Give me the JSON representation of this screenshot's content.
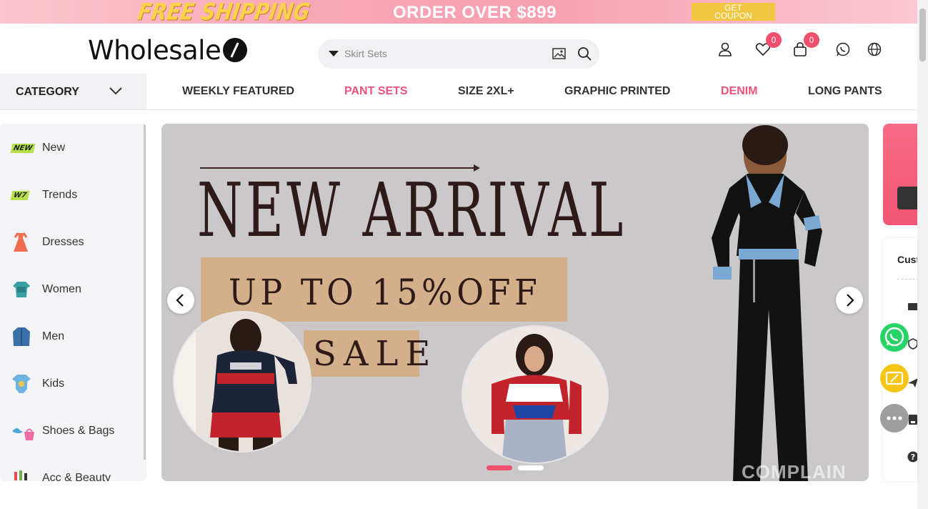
{
  "promo": {
    "free_shipping": "FREE SHIPPING",
    "order_text": "ORDER OVER $899",
    "coupon_line1": "GET",
    "coupon_line2": "COUPON"
  },
  "header": {
    "logo_text": "Wholesale",
    "search_placeholder": "Skirt Sets",
    "wishlist_count": "0",
    "cart_count": "0"
  },
  "nav": {
    "category_label": "CATEGORY",
    "links": [
      {
        "label": "WEEKLY FEATURED"
      },
      {
        "label": "PANT SETS"
      },
      {
        "label": "SIZE 2XL+"
      },
      {
        "label": "GRAPHIC PRINTED"
      },
      {
        "label": "DENIM"
      },
      {
        "label": "LONG PANTS"
      }
    ]
  },
  "sidebar": {
    "items": [
      {
        "label": "New",
        "tag": "NEW"
      },
      {
        "label": "Trends",
        "tag": "W7"
      },
      {
        "label": "Dresses"
      },
      {
        "label": "Women"
      },
      {
        "label": "Men"
      },
      {
        "label": "Kids"
      },
      {
        "label": "Shoes & Bags"
      },
      {
        "label": "Acc & Beauty"
      }
    ]
  },
  "banner": {
    "headline": "NEW ARRIVAL",
    "offer": "UP TO 15%OFF",
    "sale": "SALE",
    "watermark": "COMPLAIN",
    "slide_count": 2,
    "active_slide": 1
  },
  "right_panel": {
    "cust_label": "Cust"
  },
  "colors": {
    "accent": "#f0506e",
    "nav_pink": "#e8547a",
    "coupon": "#f1c640",
    "tan": "#d3b089"
  }
}
